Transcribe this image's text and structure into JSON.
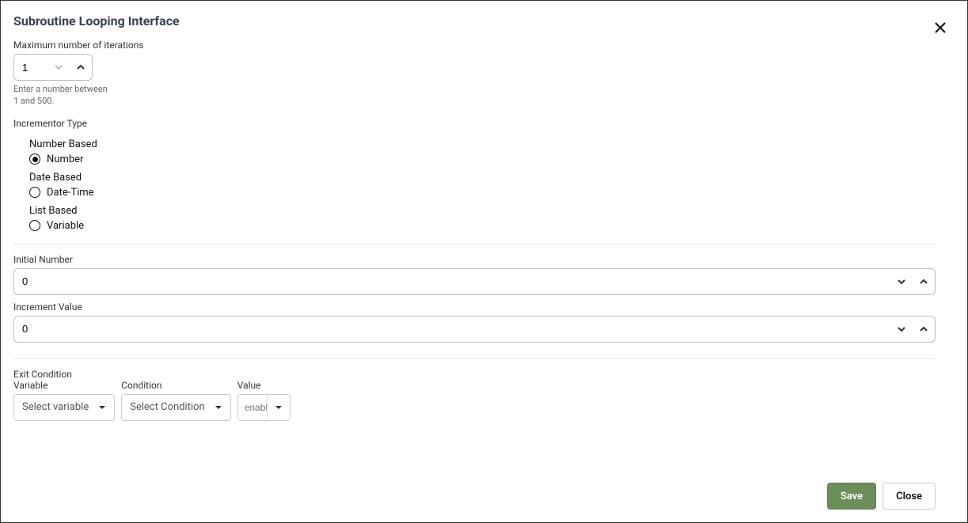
{
  "title": "Subroutine Looping Interface",
  "maxIterations": {
    "label": "Maximum number of iterations",
    "value": "1",
    "helper": "Enter a number between 1 and 500."
  },
  "incrementorType": {
    "label": "Incrementor Type",
    "groups": [
      {
        "heading": "Number Based",
        "options": [
          {
            "label": "Number",
            "selected": true
          }
        ]
      },
      {
        "heading": "Date Based",
        "options": [
          {
            "label": "Date-Time",
            "selected": false
          }
        ]
      },
      {
        "heading": "List Based",
        "options": [
          {
            "label": "Variable",
            "selected": false
          }
        ]
      }
    ]
  },
  "initialNumber": {
    "label": "Initial Number",
    "value": "0"
  },
  "incrementValue": {
    "label": "Increment Value",
    "value": "0"
  },
  "exitCondition": {
    "label": "Exit Condition",
    "variable": {
      "label": "Variable",
      "placeholder": "Select variable"
    },
    "condition": {
      "label": "Condition",
      "placeholder": "Select Condition"
    },
    "value": {
      "label": "Value",
      "placeholder": "enable"
    }
  },
  "footer": {
    "save": "Save",
    "close": "Close"
  }
}
